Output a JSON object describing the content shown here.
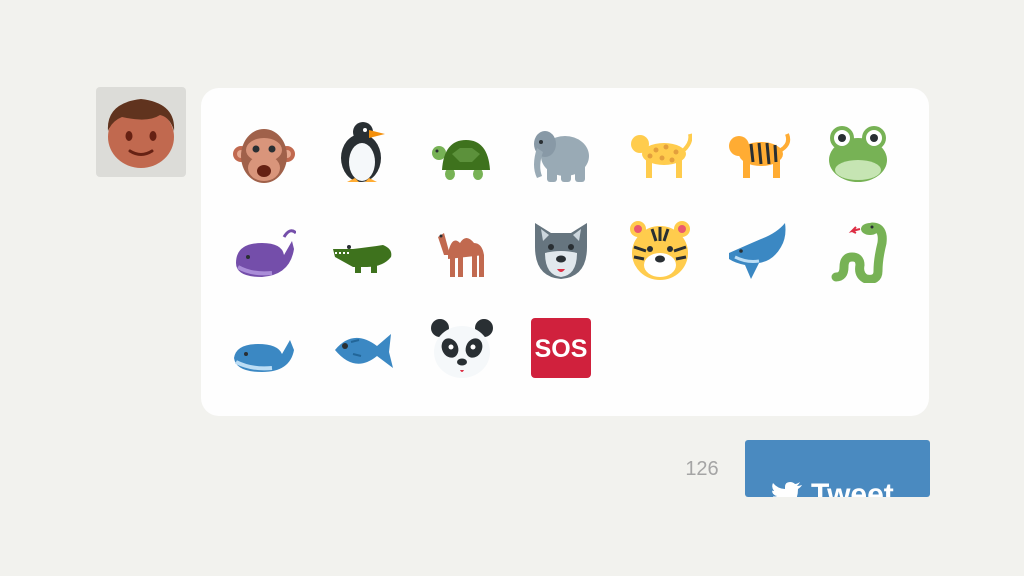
{
  "avatar": {
    "icon": "boy-face-icon"
  },
  "emoji_picker": {
    "rows": [
      [
        "monkey-face",
        "penguin",
        "turtle",
        "elephant",
        "leopard",
        "tiger",
        "frog-face"
      ],
      [
        "spouting-whale",
        "crocodile",
        "camel",
        "wolf-face",
        "tiger-face",
        "dolphin",
        "snake"
      ],
      [
        "whale",
        "fish",
        "panda-face",
        "sos-button"
      ]
    ],
    "sos_text": "SOS"
  },
  "footer": {
    "char_count": "126",
    "tweet_label": "Tweet",
    "tweet_icon": "twitter-bird-icon"
  },
  "colors": {
    "background": "#f2f2ee",
    "tweet_button": "#4a8ac0",
    "sos_red": "#d0213d"
  }
}
